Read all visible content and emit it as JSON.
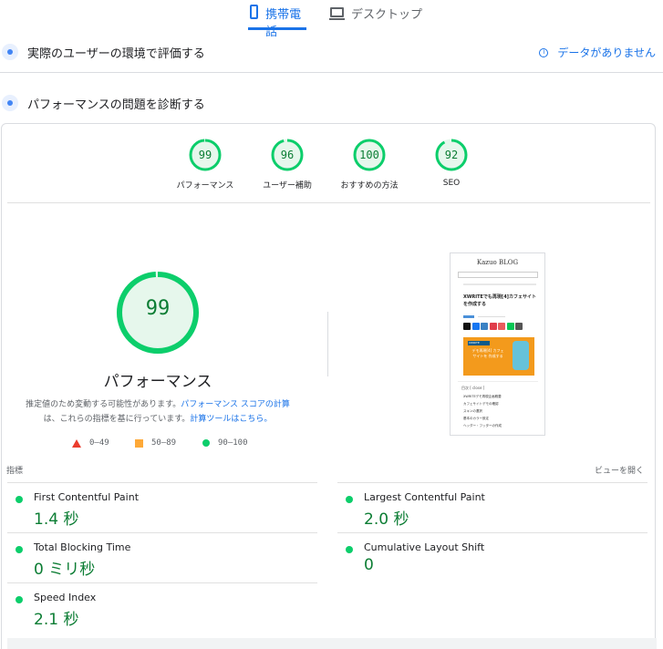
{
  "tabs": [
    {
      "label": "携帯電話",
      "icon": "phone-icon",
      "active": true
    },
    {
      "label": "デスクトップ",
      "icon": "desktop-icon",
      "active": false
    }
  ],
  "field_section": {
    "title": "実際のユーザーの環境で評価する",
    "no_data": "データがありません"
  },
  "diag_section": {
    "title": "パフォーマンスの問題を診断する"
  },
  "gauges": [
    {
      "score": "99",
      "label": "パフォーマンス",
      "fraction": 0.99
    },
    {
      "score": "96",
      "label": "ユーザー補助",
      "fraction": 0.96
    },
    {
      "score": "100",
      "label": "おすすめの方法",
      "fraction": 1.0
    },
    {
      "score": "92",
      "label": "SEO",
      "fraction": 0.92
    }
  ],
  "main_gauge": {
    "score": "99",
    "label": "パフォーマンス",
    "fraction": 0.99
  },
  "note": {
    "text1": "推定値のため変動する可能性があります。",
    "link1": "パフォーマンス スコアの計算",
    "text2": "は、これらの指標を基に行っています。",
    "link2": "計算ツールはこちら。"
  },
  "legend": [
    {
      "range": "0–49",
      "shape": "triangle",
      "color": "#eb3c2d"
    },
    {
      "range": "50–89",
      "shape": "square",
      "color": "#fea938"
    },
    {
      "range": "90–100",
      "shape": "circle",
      "color": "#0cce6b"
    }
  ],
  "thumbnail": {
    "logo": "Kazuo BLOG",
    "title": "XWRITEでも再現[4]カフェサイトを作成する",
    "hero_label": "XWRITE",
    "hero_text": "デモ再現[4] カフェサイトを 作成する",
    "toc_title": "目次 [ close ]",
    "toc_items": [
      "XWRITEデモ再現企画概要",
      "カフェサイトデモの確認",
      "スキンの選択",
      "基本のカラー設定",
      "ヘッダー・フッターの作成"
    ]
  },
  "metrics": {
    "label": "指標",
    "expand": "ビューを開く",
    "items": [
      {
        "name": "First Contentful Paint",
        "value": "1.4 秒"
      },
      {
        "name": "Largest Contentful Paint",
        "value": "2.0 秒"
      },
      {
        "name": "Total Blocking Time",
        "value": "0 ミリ秒"
      },
      {
        "name": "Cumulative Layout Shift",
        "value": "0"
      },
      {
        "name": "Speed Index",
        "value": "2.1 秒"
      }
    ]
  },
  "colors": {
    "accent": "#1a73e8",
    "pass": "#0cce6b",
    "pass_text": "#0c7d34",
    "pass_fill": "#e6f7ec"
  }
}
